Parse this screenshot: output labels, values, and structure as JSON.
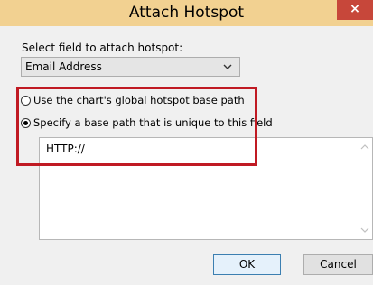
{
  "dialog": {
    "title": "Attach Hotspot",
    "close_label": "×"
  },
  "field_select": {
    "label": "Select field to attach hotspot:",
    "selected_value": "Email Address"
  },
  "options": {
    "global_label": "Use the chart's global hotspot base path",
    "unique_label": "Specify a base path that is unique to this field",
    "selected": "unique"
  },
  "base_path": {
    "value": "HTTP://"
  },
  "buttons": {
    "ok_label": "OK",
    "cancel_label": "Cancel"
  },
  "colors": {
    "titlebar": "#f2d191",
    "close": "#c7473a",
    "highlight": "#c01a23"
  }
}
